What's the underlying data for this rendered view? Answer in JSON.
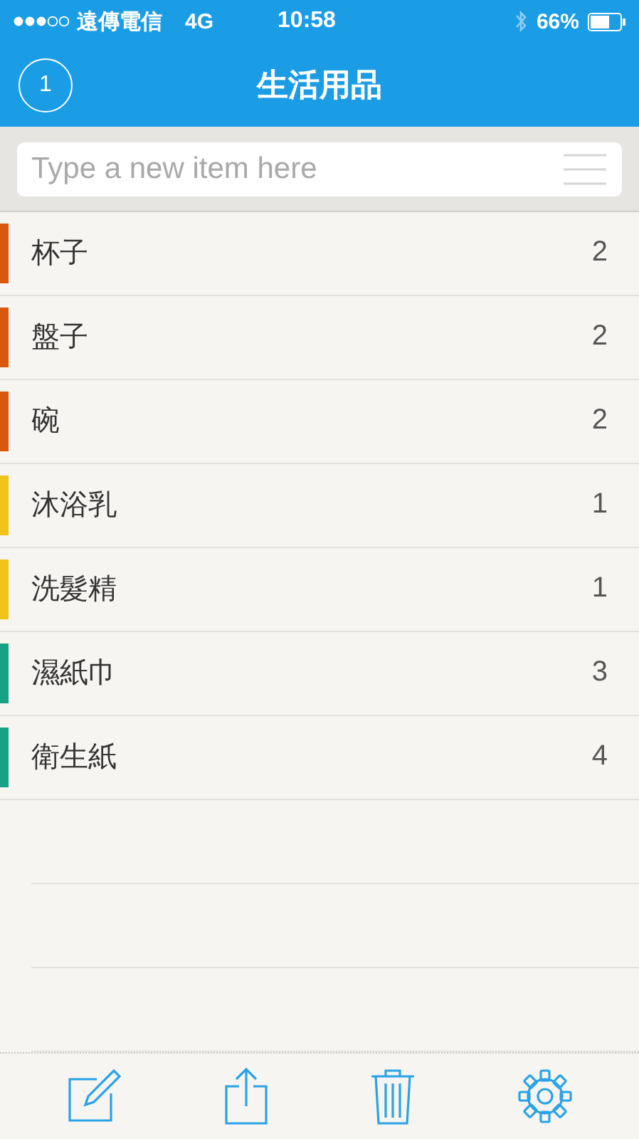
{
  "status_bar": {
    "carrier": "遠傳電信",
    "network": "4G",
    "time": "10:58",
    "battery": "66%"
  },
  "header": {
    "badge": "1",
    "title": "生活用品"
  },
  "input": {
    "placeholder": "Type a new item here"
  },
  "items": [
    {
      "name": "杯子",
      "count": "2",
      "color": "#d9580d"
    },
    {
      "name": "盤子",
      "count": "2",
      "color": "#d9580d"
    },
    {
      "name": "碗",
      "count": "2",
      "color": "#d9580d"
    },
    {
      "name": "沐浴乳",
      "count": "1",
      "color": "#f2c318"
    },
    {
      "name": "洗髮精",
      "count": "1",
      "color": "#f2c318"
    },
    {
      "name": "濕紙巾",
      "count": "3",
      "color": "#17a286"
    },
    {
      "name": "衛生紙",
      "count": "4",
      "color": "#17a286"
    }
  ]
}
